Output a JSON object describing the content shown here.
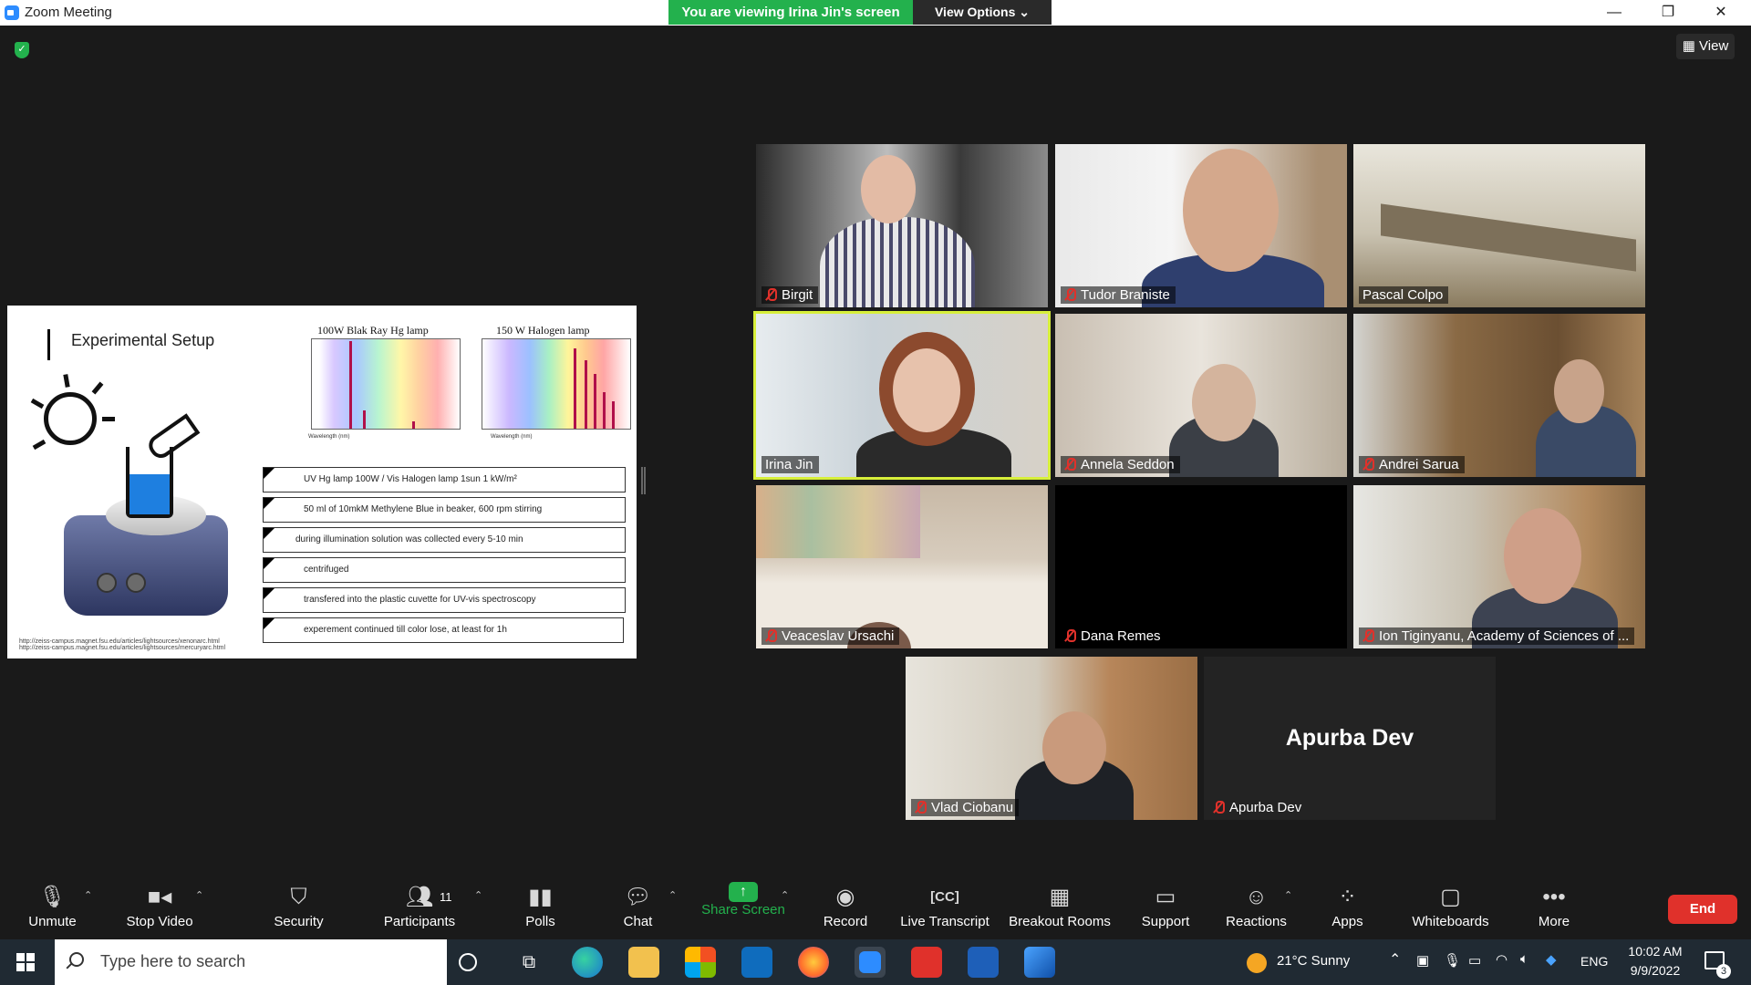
{
  "window": {
    "title": "Zoom Meeting"
  },
  "banner": {
    "viewing": "You are viewing Irina Jin's screen",
    "view_options": "View Options ⌄"
  },
  "window_controls": {
    "minimize": "—",
    "maximize": "❐",
    "close": "✕"
  },
  "view_button": {
    "label": "View"
  },
  "slide": {
    "title": "Experimental Setup",
    "spectrum_titles": [
      "100W Blak Ray Hg lamp",
      "150 W Halogen lamp"
    ],
    "axis_label": "Wavelength (nm)",
    "steps": [
      "UV Hg lamp 100W / Vis Halogen lamp 1sun 1 kW/m²",
      "50 ml of 10mkM Methylene Blue in beaker, 600 rpm stirring",
      "during illumination solution was collected every 5-10 min",
      "centrifuged",
      "transfered into the plastic cuvette for UV-vis spectroscopy",
      "experement continued till color lose, at least for 1h"
    ],
    "urls": [
      "http://zeiss-campus.magnet.fsu.edu/articles/lightsources/xenonarc.html",
      "http://zeiss-campus.magnet.fsu.edu/articles/lightsources/mercuryarc.html"
    ]
  },
  "participants": [
    {
      "name": "Birgit",
      "muted": true
    },
    {
      "name": "Tudor Braniste",
      "muted": true
    },
    {
      "name": "Pascal Colpo",
      "muted": false
    },
    {
      "name": "Irina Jin",
      "muted": false,
      "active_speaker": true
    },
    {
      "name": "Annela Seddon",
      "muted": true
    },
    {
      "name": "Andrei Sarua",
      "muted": true
    },
    {
      "name": "Veaceslav Ursachi",
      "muted": true
    },
    {
      "name": "Dana Remes",
      "muted": true
    },
    {
      "name": "Ion Tiginyanu, Academy of Sciences of ...",
      "muted": true
    },
    {
      "name": "Vlad Ciobanu",
      "muted": true
    },
    {
      "name": "Apurba Dev",
      "muted": true,
      "video_off": true,
      "display_name": "Apurba Dev"
    }
  ],
  "toolbar": {
    "unmute": "Unmute",
    "stop_video": "Stop Video",
    "security": "Security",
    "participants": "Participants",
    "participant_count": "11",
    "polls": "Polls",
    "chat": "Chat",
    "share_screen": "Share Screen",
    "record": "Record",
    "live_transcript": "Live Transcript",
    "breakout_rooms": "Breakout Rooms",
    "support": "Support",
    "reactions": "Reactions",
    "apps": "Apps",
    "whiteboards": "Whiteboards",
    "more": "More",
    "end": "End"
  },
  "taskbar": {
    "search_placeholder": "Type here to search",
    "weather": "21°C  Sunny",
    "language": "ENG",
    "time": "10:02 AM",
    "date": "9/9/2022",
    "notifications": "3"
  },
  "colors": {
    "accent_green": "#23b14d",
    "end_red": "#e0312b",
    "active_border": "#d7ef3a",
    "muted_red": "#e0312b"
  }
}
